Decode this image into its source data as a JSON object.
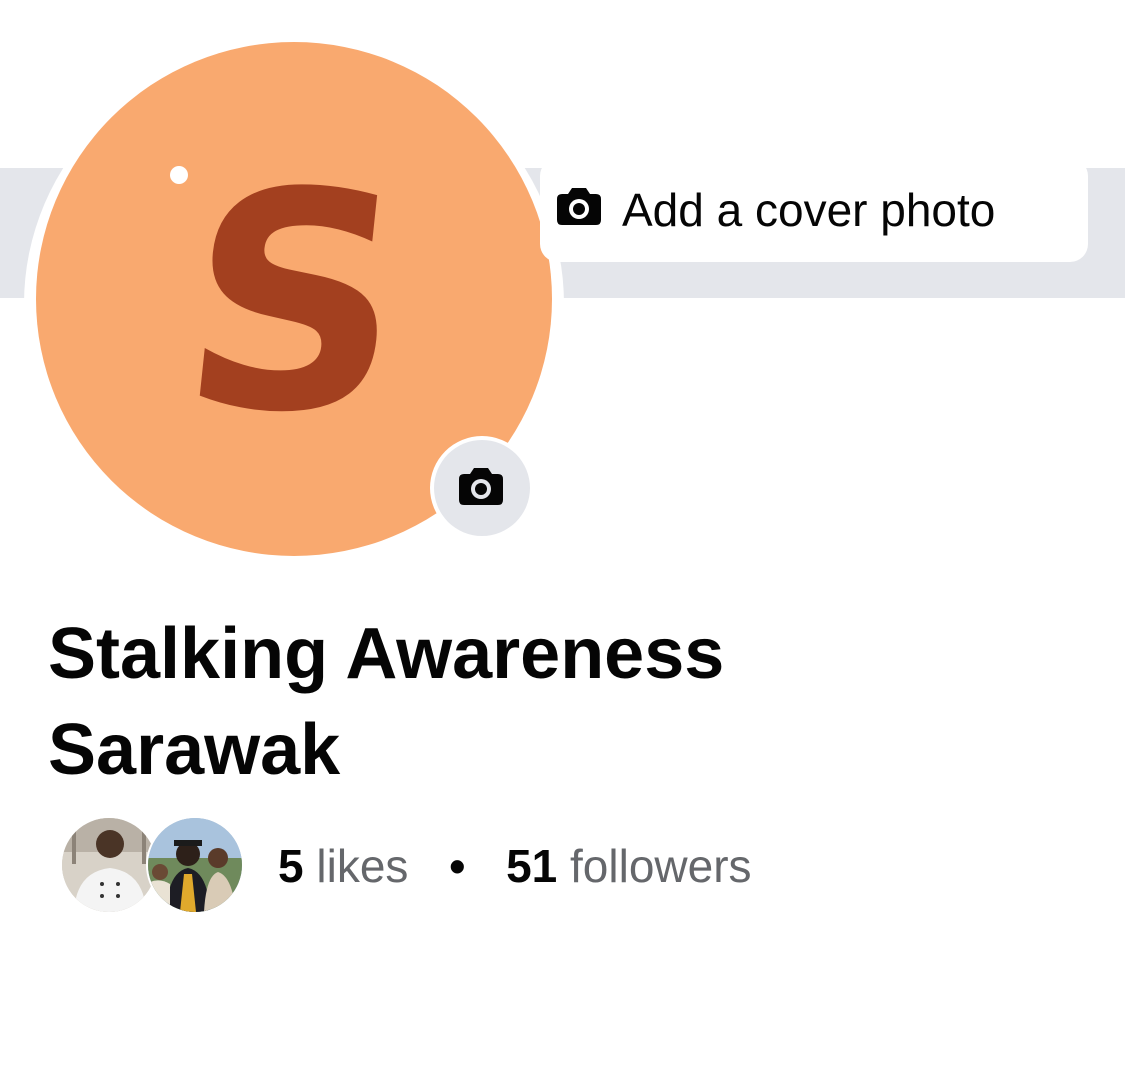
{
  "cover": {
    "add_cover_label": "Add a cover photo",
    "icon": "camera-icon"
  },
  "avatar": {
    "letter": "S",
    "background": "#f9a96f",
    "letter_color": "#a3401f",
    "camera_icon": "camera-icon"
  },
  "page": {
    "name": "Stalking Awareness Sarawak"
  },
  "stats": {
    "likes_count": "5",
    "likes_label": "likes",
    "separator": "•",
    "followers_count": "51",
    "followers_label": "followers"
  },
  "colors": {
    "cover_gray": "#e4e6eb",
    "text_primary": "#050505",
    "text_secondary": "#65676b"
  }
}
